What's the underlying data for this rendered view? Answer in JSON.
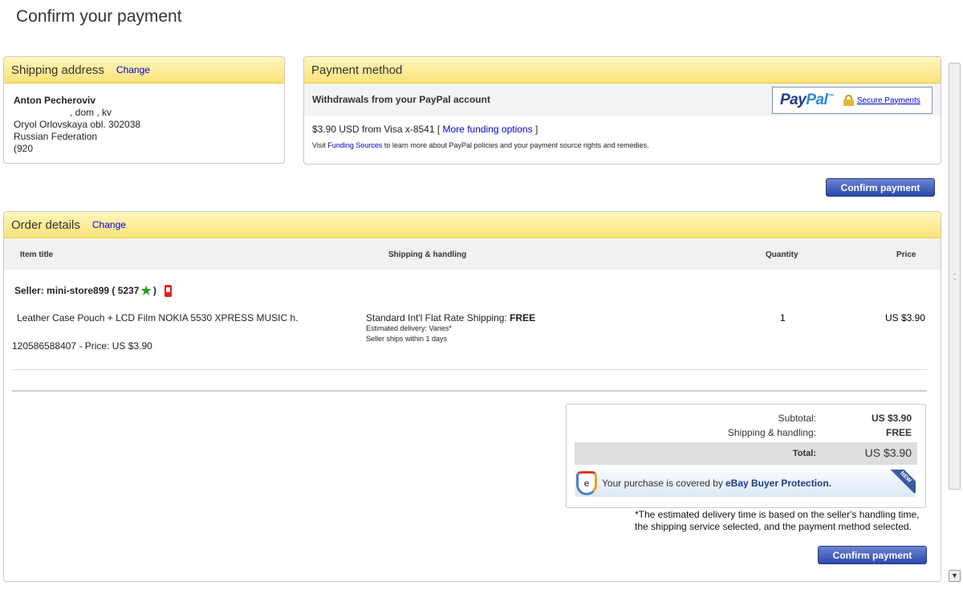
{
  "page": {
    "title": "Confirm your payment"
  },
  "shipping": {
    "heading": "Shipping address",
    "change": "Change",
    "name": "Anton Pecheroviv",
    "street": ", dom      , kv",
    "city": "Oryol Orlovskaya obl. 302038",
    "country": "Russian Federation",
    "phone": "(920"
  },
  "payment": {
    "heading": "Payment method",
    "withdrawal_label": "Withdrawals from your PayPal account",
    "paypal_logo_pay": "Pay",
    "paypal_logo_pal": "Pal",
    "paypal_tm": "™",
    "secure_payments": "Secure Payments",
    "funding_line": "$3.90 USD from Visa x-8541 [",
    "more_funding": "More funding options",
    "funding_close": "]",
    "note_prefix": "Visit",
    "funding_sources": "Funding Sources",
    "note_suffix": "to learn more about PayPal policies and your payment source rights and remedies."
  },
  "confirm_button": "Confirm payment",
  "order": {
    "heading": "Order details",
    "change": "Change",
    "columns": {
      "item_title": "Item title",
      "shipping": "Shipping & handling",
      "quantity": "Quantity",
      "price": "Price"
    },
    "seller_label": "Seller: mini-store899 ( 5237",
    "seller_close": ")",
    "item": {
      "title": "Leather Case Pouch + LCD Film NOKIA 5530 XPRESS MUSIC h.",
      "id_price": "120586588407 - Price: US $3.90",
      "shipping_main": "Standard Int'l Flat Rate Shipping:",
      "shipping_free": "FREE",
      "estimated": "Estimated delivery: Varies*",
      "ships_within": "Seller ships within 1 days",
      "quantity": "1",
      "price": "US $3.90"
    },
    "totals": {
      "subtotal_label": "Subtotal:",
      "subtotal": "US $3.90",
      "shipping_label": "Shipping & handling:",
      "shipping": "FREE",
      "total_label": "Total:",
      "total": "US $3.90"
    },
    "protection_text": "Your purchase is covered by",
    "protection_brand": "eBay Buyer Protection.",
    "protection_badge": "NEW",
    "footnote": "*The estimated delivery time is based on the seller's handling time, the shipping service selected, and the payment method selected."
  },
  "icons": {
    "star": "star-icon",
    "phone": "phone-icon",
    "lock": "lock-icon",
    "shield": "shield-icon"
  },
  "colors": {
    "link": "#0000cc",
    "header_yellow": "#fbe27a",
    "button_blue": "#2b49ab",
    "star_green": "#2a9d1f",
    "phone_red": "#d8231d"
  }
}
